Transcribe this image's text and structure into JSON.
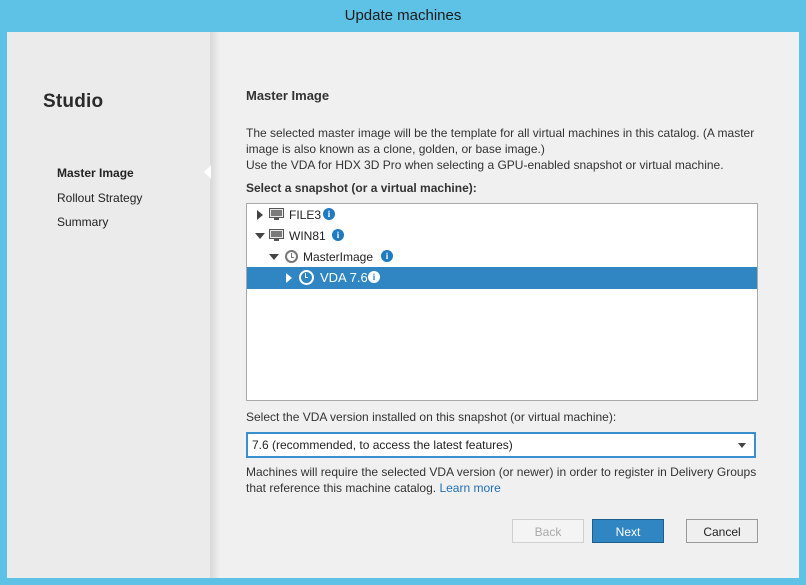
{
  "window": {
    "title": "Update machines"
  },
  "sidebar": {
    "brand": "Studio",
    "items": [
      {
        "label": "Master Image",
        "active": true
      },
      {
        "label": "Rollout Strategy",
        "active": false
      },
      {
        "label": "Summary",
        "active": false
      }
    ]
  },
  "main": {
    "section_title": "Master Image",
    "description_line1": "The selected master image will be the template for all virtual machines in this catalog. (A master image is also known as a clone, golden, or base image.)",
    "description_line2": "Use the VDA for HDX 3D Pro when selecting a GPU-enabled snapshot or virtual machine.",
    "snapshot_label": "Select a snapshot (or a virtual machine):",
    "tree": [
      {
        "label": "FILE3",
        "icon": "monitor-icon",
        "expanded": false,
        "selected": false
      },
      {
        "label": "WIN81",
        "icon": "monitor-icon",
        "expanded": true,
        "selected": false
      },
      {
        "label": "MasterImage",
        "icon": "snapshot-clock-icon",
        "expanded": true,
        "selected": false
      },
      {
        "label": "VDA 7.6",
        "icon": "snapshot-clock-icon",
        "expanded": false,
        "selected": true
      }
    ],
    "vda_label": "Select the VDA version installed on this snapshot (or virtual machine):",
    "vda_selected": "7.6 (recommended, to access the latest features)",
    "note_text": "Machines will require the selected VDA version (or newer) in order to register in Delivery Groups that reference this machine catalog.",
    "note_link": "Learn more"
  },
  "buttons": {
    "back": "Back",
    "next": "Next",
    "cancel": "Cancel"
  },
  "colors": {
    "titlebar": "#5ec2e6",
    "selection": "#2f86c2",
    "link": "#1f6fb5",
    "info_icon": "#1f7ac2"
  }
}
